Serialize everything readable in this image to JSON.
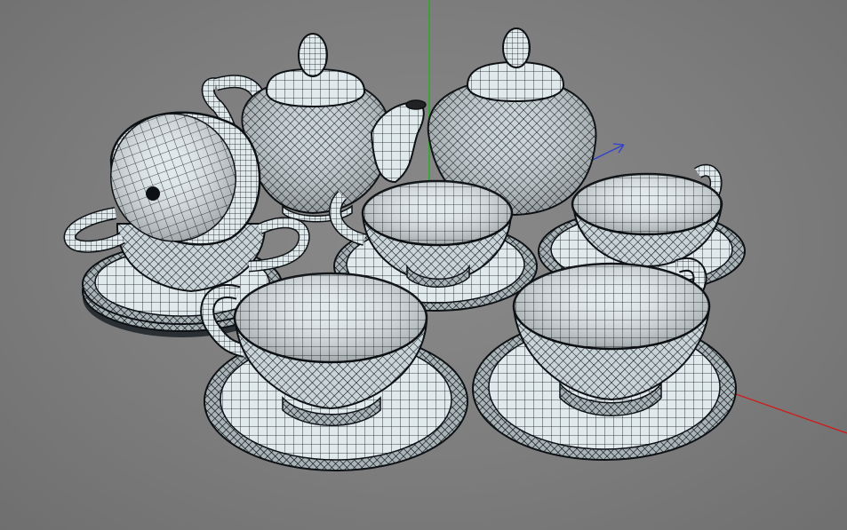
{
  "viewport": {
    "background": "#7c7c7c",
    "axes": {
      "x_color": "#d01a1a",
      "y_color": "#1fb01f",
      "z_color": "#3040d0"
    },
    "wire_color": "#101418",
    "surface_color": "#dce6ea"
  },
  "objects": {
    "teapot": {
      "icon": "teapot-wireframe"
    },
    "sugar_bowl": {
      "icon": "sugar-bowl-wireframe"
    },
    "cups": {
      "count": 5,
      "icon": "teacup-wireframe"
    },
    "saucers": {
      "count": 6,
      "icon": "saucer-wireframe"
    }
  }
}
